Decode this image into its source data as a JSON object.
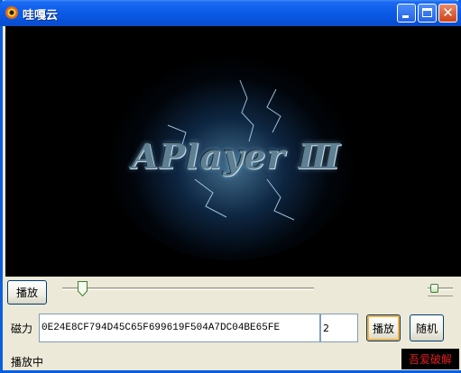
{
  "window": {
    "title": "哇嘎云",
    "close_glyph": "✕"
  },
  "player": {
    "logo_text": "APlayer Ⅲ"
  },
  "controls": {
    "play_label": "播放",
    "seek_position": 0.08,
    "volume_level": 0.1
  },
  "magnet": {
    "label": "磁力",
    "value": "0E24E8CF794D45C65F699619F504A7DC04BE65FE",
    "count": "2",
    "play_label": "播放",
    "random_label": "随机"
  },
  "status": {
    "text": "播放中",
    "badge": "吾爱破解"
  },
  "colors": {
    "titlebar": "#0b5ce9",
    "video_bg": "#000000",
    "badge_text": "#e02020"
  }
}
